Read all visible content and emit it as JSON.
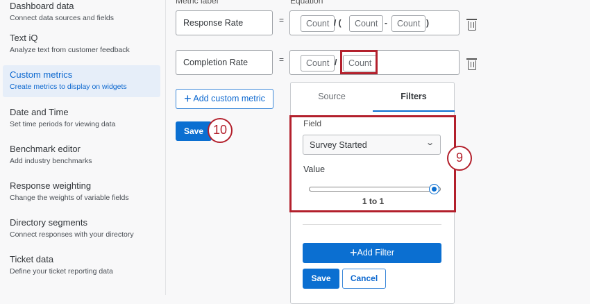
{
  "sidebar": {
    "items": [
      {
        "title": "Dashboard data",
        "subtitle": "Connect data sources and fields"
      },
      {
        "title": "Text iQ",
        "subtitle": "Analyze text from customer feedback"
      },
      {
        "title": "Custom metrics",
        "subtitle": "Create metrics to display on widgets"
      },
      {
        "title": "Date and Time",
        "subtitle": "Set time periods for viewing data"
      },
      {
        "title": "Benchmark editor",
        "subtitle": "Add industry benchmarks"
      },
      {
        "title": "Response weighting",
        "subtitle": "Change the weights of variable fields"
      },
      {
        "title": "Directory segments",
        "subtitle": "Connect responses with your directory"
      },
      {
        "title": "Ticket data",
        "subtitle": "Define your ticket reporting data"
      }
    ]
  },
  "main": {
    "metric_label_header": "Metric label",
    "equation_header": "Equation",
    "equals": "=",
    "metrics": [
      {
        "label": "Response Rate",
        "tokens": [
          "Count",
          "/ (",
          "Count",
          "-",
          "Count",
          ")"
        ]
      },
      {
        "label": "Completion Rate",
        "tokens": [
          "Count",
          "/",
          "Count"
        ]
      }
    ],
    "add_metric": "Add custom metric",
    "save": "Save"
  },
  "popover": {
    "tabs": [
      "Source",
      "Filters"
    ],
    "active_tab": "Filters",
    "field_label": "Field",
    "field_value": "Survey Started",
    "value_label": "Value",
    "slider_value": 1.0,
    "range_text": "1 to 1",
    "add_filter": "Add Filter",
    "save": "Save",
    "cancel": "Cancel"
  },
  "callouts": [
    "10",
    "9"
  ],
  "colors": {
    "accent": "#0b6fd1",
    "callout": "#b3202c"
  }
}
